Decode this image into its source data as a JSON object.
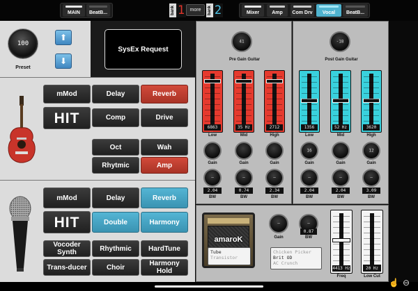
{
  "topbar": {
    "main_label": "MAIN",
    "beatb_left_label": "BeatB...",
    "bank_label": "bank",
    "bank1_number": "1",
    "more_label": "more",
    "bank2_number": "2",
    "mixer_label": "Mixer",
    "amp_label": "Amp",
    "comdrv_label": "Com Drv",
    "vocal_label": "Vocal",
    "beatb_right_label": "BeatB..."
  },
  "preset": {
    "value": "100",
    "label": "Preset"
  },
  "sysex_label": "SysEx Request",
  "guitar": {
    "row1": [
      "mMod",
      "Delay",
      "Reverb"
    ],
    "hit": "HIT",
    "row2": [
      "Comp",
      "Drive"
    ],
    "row3": [
      "Oct",
      "Wah"
    ],
    "row4": [
      "Rhytmic",
      "Amp"
    ]
  },
  "vocal": {
    "row1": [
      "mMod",
      "Delay",
      "Reverb"
    ],
    "hit": "HIT",
    "row2": [
      "Double",
      "Harmony"
    ],
    "row3": [
      "Vocoder Synth",
      "Rhythmic",
      "HardTune"
    ],
    "row4": [
      "Trans-ducer",
      "Choir",
      "Harmony Hold"
    ]
  },
  "pre_eq": {
    "knob_value": "41",
    "title": "Pre Gain Guitar",
    "bands": [
      {
        "freq": "6863 Hz",
        "name": "Low",
        "gain_knob": "",
        "bw": "2.04"
      },
      {
        "freq": "35 Hz",
        "name": "Mid",
        "gain_knob": "",
        "bw": "0.74"
      },
      {
        "freq": "2712 Hz",
        "name": "High",
        "gain_knob": "",
        "bw": "2.34"
      }
    ]
  },
  "post_eq": {
    "knob_value": "-18",
    "title": "Post Gain Guitar",
    "bands": [
      {
        "freq": "1356 Hz",
        "name": "Low",
        "gain_knob": "16",
        "bw": "2.04"
      },
      {
        "freq": "52 Hz",
        "name": "Mid",
        "gain_knob": "",
        "bw": "2.04"
      },
      {
        "freq": "3620 Hz",
        "name": "High",
        "gain_knob": "12",
        "bw": "3.09"
      }
    ]
  },
  "knob_labels": {
    "gain": "Gain",
    "bw": "BW"
  },
  "amp_section": {
    "brand": "amaroK",
    "gain_label": "Gain",
    "bw_label": "BW",
    "bw_value": "0.87",
    "type_list": [
      "Tube",
      "Transistor"
    ],
    "model_list": [
      "Chicken Picker",
      "Brit OD",
      "AC Crunch"
    ],
    "freq_value": "4413 Hz",
    "freq_label": "Freq",
    "lowcut_value": "20 Hz",
    "lowcut_label": "Low Cut"
  },
  "colors": {
    "red_fader": "#e53a2e",
    "cyan_fader": "#39d1dd",
    "red_button": "#c63f30",
    "blue_button": "#4aa9c9"
  }
}
